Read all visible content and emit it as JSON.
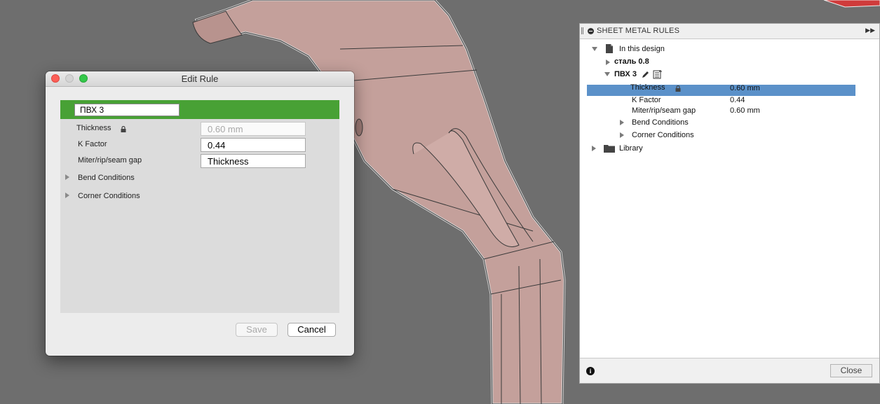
{
  "colors": {
    "viewport_bg": "#6e6e6e",
    "model_fill": "#c4a09b",
    "rule_header_green": "#48a135",
    "selection_blue": "#5b91c9"
  },
  "edit_rule_dialog": {
    "title": "Edit Rule",
    "rule_name": "ПВХ 3",
    "thickness_label": "Thickness",
    "thickness_value": "0.60 mm",
    "k_factor_label": "K Factor",
    "k_factor_value": "0.44",
    "miter_label": "Miter/rip/seam gap",
    "miter_value": "Thickness",
    "bend_conditions_label": "Bend Conditions",
    "corner_conditions_label": "Corner Conditions",
    "save_label": "Save",
    "cancel_label": "Cancel"
  },
  "sheet_metal_rules": {
    "title": "SHEET METAL RULES",
    "in_this_design_label": "In this design",
    "rule_1": "сталь 0.8",
    "rule_2": "ПВХ 3",
    "thickness_label": "Thickness",
    "thickness_value": "0.60 mm",
    "k_factor_label": "K Factor",
    "k_factor_value": "0.44",
    "miter_label": "Miter/rip/seam gap",
    "miter_value": "0.60 mm",
    "bend_conditions_label": "Bend Conditions",
    "corner_conditions_label": "Corner Conditions",
    "library_label": "Library",
    "close_label": "Close"
  }
}
